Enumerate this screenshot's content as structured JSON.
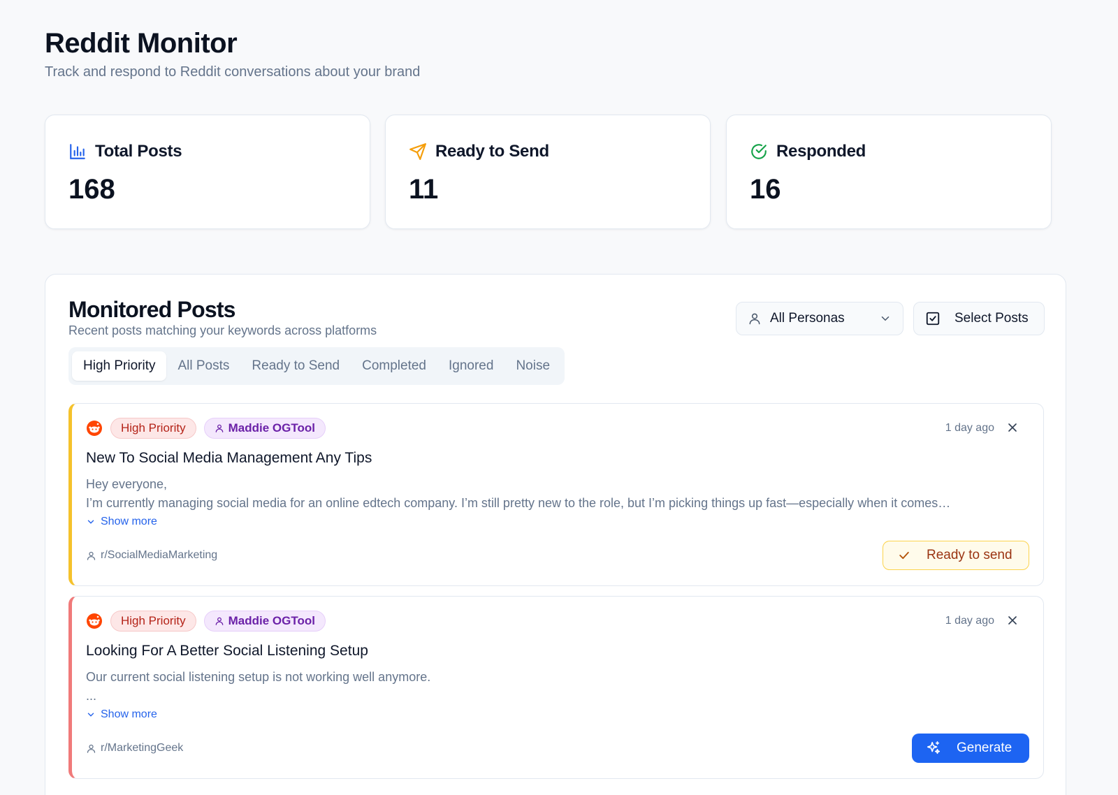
{
  "header": {
    "title": "Reddit Monitor",
    "subtitle": "Track and respond to Reddit conversations about your brand"
  },
  "stats": [
    {
      "label": "Total Posts",
      "value": "168",
      "icon": "bar-chart-icon",
      "color": "#2563eb"
    },
    {
      "label": "Ready to Send",
      "value": "11",
      "icon": "send-icon",
      "color": "#f59e0b"
    },
    {
      "label": "Responded",
      "value": "16",
      "icon": "check-circle-icon",
      "color": "#16a34a"
    }
  ],
  "panel": {
    "title": "Monitored Posts",
    "subtitle": "Recent posts matching your keywords across platforms",
    "persona_select": "All Personas",
    "select_posts": "Select Posts",
    "tabs": [
      "High Priority",
      "All Posts",
      "Ready to Send",
      "Completed",
      "Ignored",
      "Noise"
    ],
    "active_tab": "High Priority"
  },
  "posts": [
    {
      "priority": "High Priority",
      "persona": "Maddie OGTool",
      "time": "1 day ago",
      "title": "New To Social Media Management Any Tips",
      "body_line1": "Hey everyone,",
      "body_line2": "I’m currently managing social media for an online edtech company. I’m still pretty new to the role, but I’m picking things up fast—especially when it comes…",
      "show_more": "Show more",
      "subreddit": "r/SocialMediaMarketing",
      "action": "Ready to send",
      "accent": "#f5c22c"
    },
    {
      "priority": "High Priority",
      "persona": "Maddie OGTool",
      "time": "1 day ago",
      "title": "Looking For A Better Social Listening Setup",
      "body_line1": "Our current social listening setup is not working well anymore.",
      "body_line2": "...",
      "show_more": "Show more",
      "subreddit": "r/MarketingGeek",
      "action": "Generate",
      "accent": "#f07a7a"
    }
  ]
}
